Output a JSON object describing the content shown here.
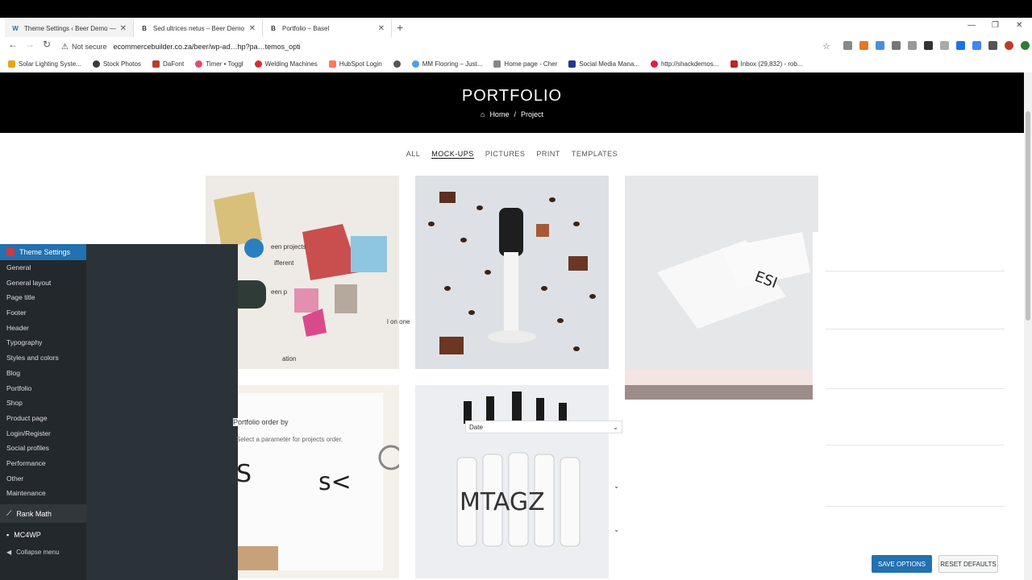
{
  "browser": {
    "tabs": [
      {
        "favicon": "W",
        "title": "Theme Settings ‹ Beer Demo —",
        "active": true
      },
      {
        "favicon": "B",
        "title": "Sed ultrices netus – Beer Demo",
        "active": false
      },
      {
        "favicon": "B",
        "title": "Portfolio – Basel",
        "active": false
      }
    ],
    "address": {
      "security": "Not secure",
      "url": "ecommercebuilder.co.za/beer/wp-ad…hp?pa…temos_opti"
    },
    "bookmarks": [
      {
        "label": "Solar Lighting Syste...",
        "color": "#e8a317"
      },
      {
        "label": "Stock Photos",
        "color": "#3a3a3a"
      },
      {
        "label": "DaFont",
        "color": "#c0392b"
      },
      {
        "label": "Timer • Toggl",
        "color": "#e44d6a"
      },
      {
        "label": "Welding Machines",
        "color": "#d63031"
      },
      {
        "label": "HubSpot Login",
        "color": "#ff7a59"
      },
      {
        "label": "",
        "color": "#555"
      },
      {
        "label": "MM Flooring – Just...",
        "color": "#4aa3df"
      },
      {
        "label": "Home page - Cher",
        "color": "#888"
      },
      {
        "label": "Social Media Mana...",
        "color": "#1e3a8a"
      },
      {
        "label": "http://shackdemos...",
        "color": "#e11d48"
      },
      {
        "label": "Inbox (29,832) - rob...",
        "color": "#c5221f"
      }
    ]
  },
  "page": {
    "title": "PORTFOLIO",
    "breadcrumb": {
      "home": "Home",
      "separator": "/",
      "current": "Project"
    },
    "filters": [
      {
        "label": "ALL",
        "active": false
      },
      {
        "label": "MOCK-UPS",
        "active": true
      },
      {
        "label": "PICTURES",
        "active": false
      },
      {
        "label": "PRINT",
        "active": false
      },
      {
        "label": "TEMPLATES",
        "active": false
      }
    ]
  },
  "wp_sidebar": {
    "heading": "Theme Settings",
    "items": [
      "General",
      "General layout",
      "Page title",
      "Footer",
      "Header",
      "Typography",
      "Styles and colors",
      "Blog",
      "Portfolio",
      "Shop",
      "Product page",
      "Login/Register",
      "Social profiles",
      "Performance",
      "Other",
      "Maintenance"
    ],
    "rank_math": "Rank Math",
    "mc4wp": "MC4WP",
    "collapse": "Collapse menu"
  },
  "overlay": {
    "green_projects": "een projects",
    "different": "ifferent",
    "green_p": "een p",
    "on_one": "l on one",
    "ation": "ation",
    "portfolio_order_by": "Portfolio order by",
    "param_help": "Select a parameter for projects order.",
    "date_select": "Date"
  },
  "buttons": {
    "save": "SAVE OPTIONS",
    "reset": "RESET DEFAULTS"
  },
  "colors": {
    "wp_blue": "#2271b1",
    "wp_dark": "#23282d",
    "hero_bg": "#000000"
  }
}
